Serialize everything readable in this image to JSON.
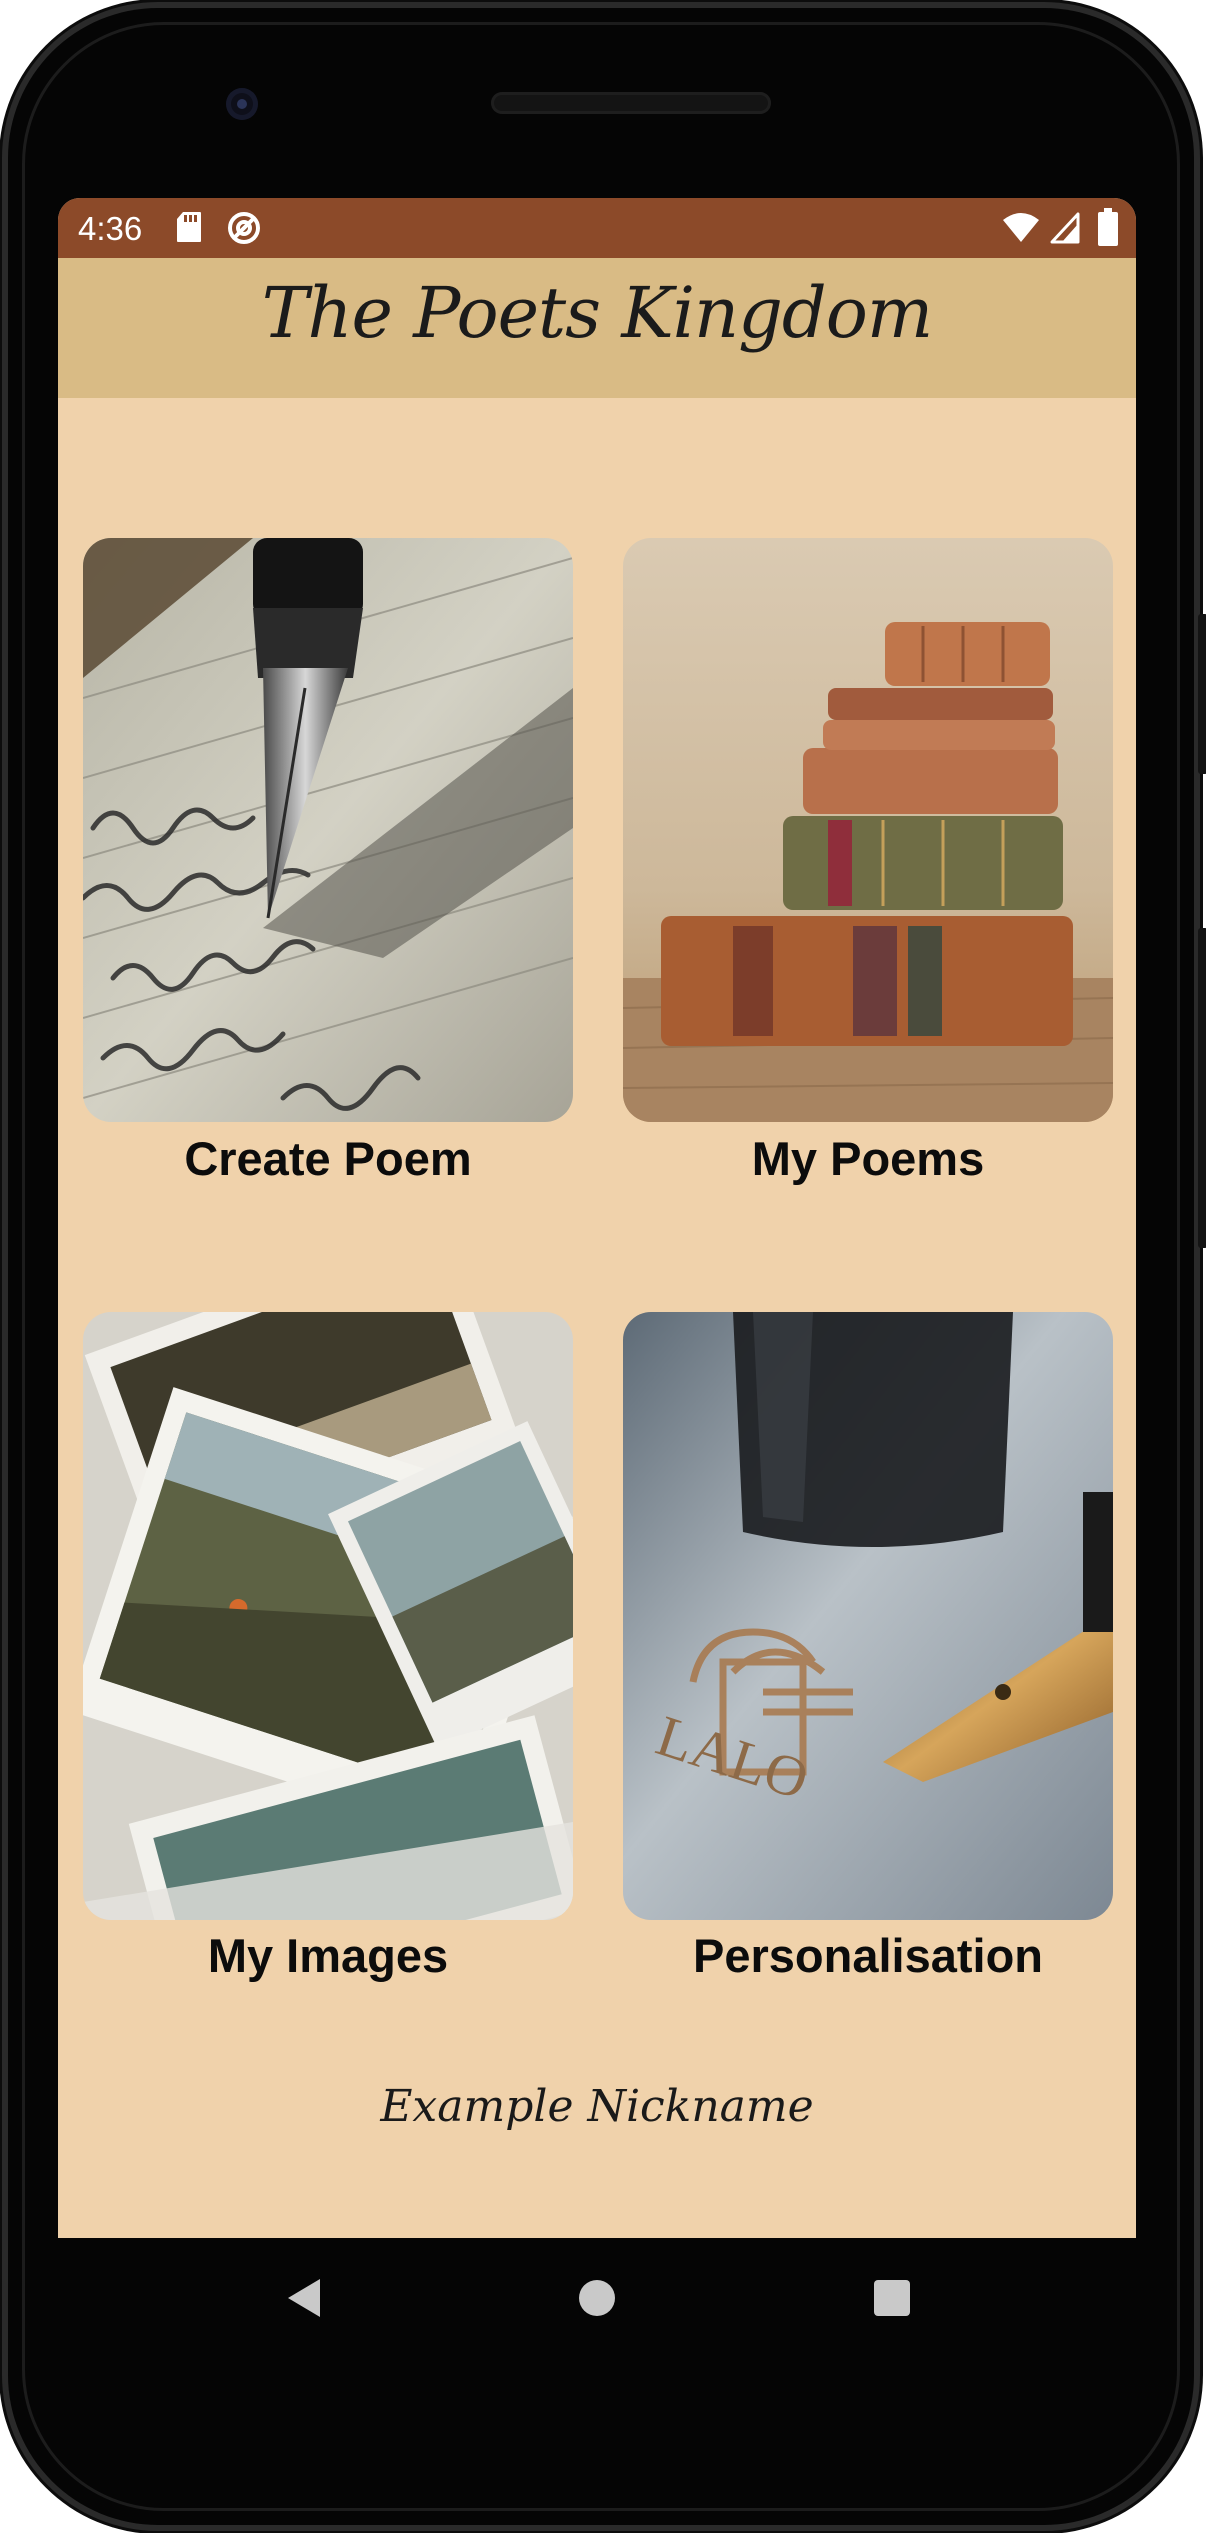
{
  "status_bar": {
    "time": "4:36",
    "icons": [
      "sd-card-icon",
      "sync-icon",
      "wifi-icon",
      "signal-icon",
      "battery-icon"
    ]
  },
  "header": {
    "title": "The Poets Kingdom",
    "background": "#d9bb85"
  },
  "tiles": [
    {
      "label": "Create Poem",
      "image": "fountain-pen-writing-photo"
    },
    {
      "label": "My Poems",
      "image": "stack-of-old-books-photo"
    },
    {
      "label": "My Images",
      "image": "scattered-photographs-photo"
    },
    {
      "label": "Personalisation",
      "image": "pen-nib-and-inkwell-photo"
    }
  ],
  "footer": {
    "nickname": "Example Nickname"
  },
  "colors": {
    "status_bar": "#8c4a29",
    "screen_background": "#f0d2ab",
    "header": "#d9bb85",
    "text": "#0c0c0c"
  },
  "nav": {
    "icons": [
      "back-icon",
      "home-icon",
      "recents-icon"
    ]
  }
}
